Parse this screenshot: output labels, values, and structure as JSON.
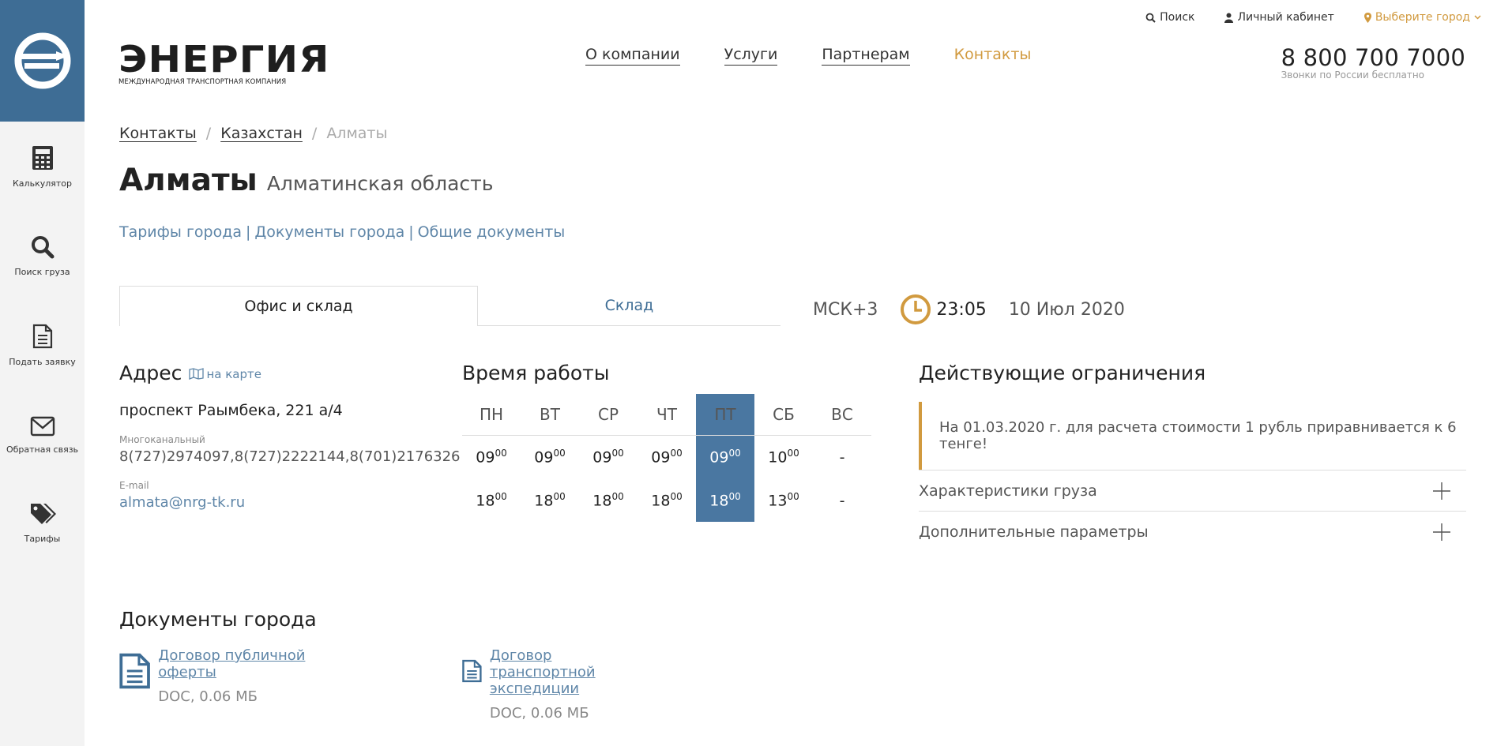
{
  "brand": {
    "name": "ЭНЕРГИЯ",
    "tagline": "МЕЖДУНАРОДНАЯ ТРАНСПОРТНАЯ КОМПАНИЯ",
    "accent": "#3e6d95",
    "gold": "#d19a3f"
  },
  "sidebar": {
    "items": [
      {
        "label": "Калькулятор",
        "icon": "calculator-icon"
      },
      {
        "label": "Поиск груза",
        "icon": "search-icon"
      },
      {
        "label": "Подать заявку",
        "icon": "document-icon"
      },
      {
        "label": "Обратная связь",
        "icon": "envelope-icon"
      },
      {
        "label": "Тарифы",
        "icon": "tags-icon"
      }
    ]
  },
  "top_links": {
    "search": "Поиск",
    "cabinet": "Личный кабинет",
    "city": "Выберите город"
  },
  "nav": {
    "items": [
      "О компании",
      "Услуги",
      "Партнерам",
      "Контакты"
    ],
    "active": "Контакты"
  },
  "phone": {
    "number": "8 800 700 7000",
    "note": "Звонки по России бесплатно"
  },
  "breadcrumb": {
    "items": [
      "Контакты",
      "Казахстан",
      "Алматы"
    ],
    "sep": "/"
  },
  "page": {
    "title": "Алматы",
    "region": "Алматинская область"
  },
  "sub_links": {
    "items": [
      "Тарифы города",
      "Документы города",
      "Общие документы"
    ],
    "sep": "|"
  },
  "tabs": {
    "active": "Офис и склад",
    "other": "Склад"
  },
  "time": {
    "tz": "МСК+3",
    "time": "23:05",
    "date": "10 Июл 2020"
  },
  "address": {
    "heading": "Адрес",
    "map_link": "на карте",
    "street": "проспект Раымбека, 221 а/4",
    "phone_label": "Многоканальный",
    "phones": "8(727)2974097,8(727)2222144,8(701)2176326",
    "email_label": "E-mail",
    "email": "almata@nrg-tk.ru"
  },
  "hours": {
    "heading": "Время работы",
    "days": [
      "ПН",
      "ВТ",
      "СР",
      "ЧТ",
      "ПТ",
      "СБ",
      "ВС"
    ],
    "today_index": 4,
    "open_h": [
      "09",
      "09",
      "09",
      "09",
      "09",
      "10",
      "-"
    ],
    "open_m": [
      "00",
      "00",
      "00",
      "00",
      "00",
      "00",
      ""
    ],
    "close_h": [
      "18",
      "18",
      "18",
      "18",
      "18",
      "13",
      "-"
    ],
    "close_m": [
      "00",
      "00",
      "00",
      "00",
      "00",
      "00",
      ""
    ]
  },
  "restrictions": {
    "heading": "Действующие ограничения",
    "notice": "На 01.03.2020 г. для расчета стоимости 1 рубль приравнивается к 6 тенге!",
    "accordions": [
      "Характеристики груза",
      "Дополнительные параметры"
    ]
  },
  "documents": {
    "heading": "Документы города",
    "items": [
      {
        "title": "Договор публичной оферты",
        "meta": "DOC, 0.06 МБ"
      },
      {
        "title": "Договор транспортной экспедиции",
        "meta": "DOC, 0.06 МБ"
      }
    ]
  }
}
